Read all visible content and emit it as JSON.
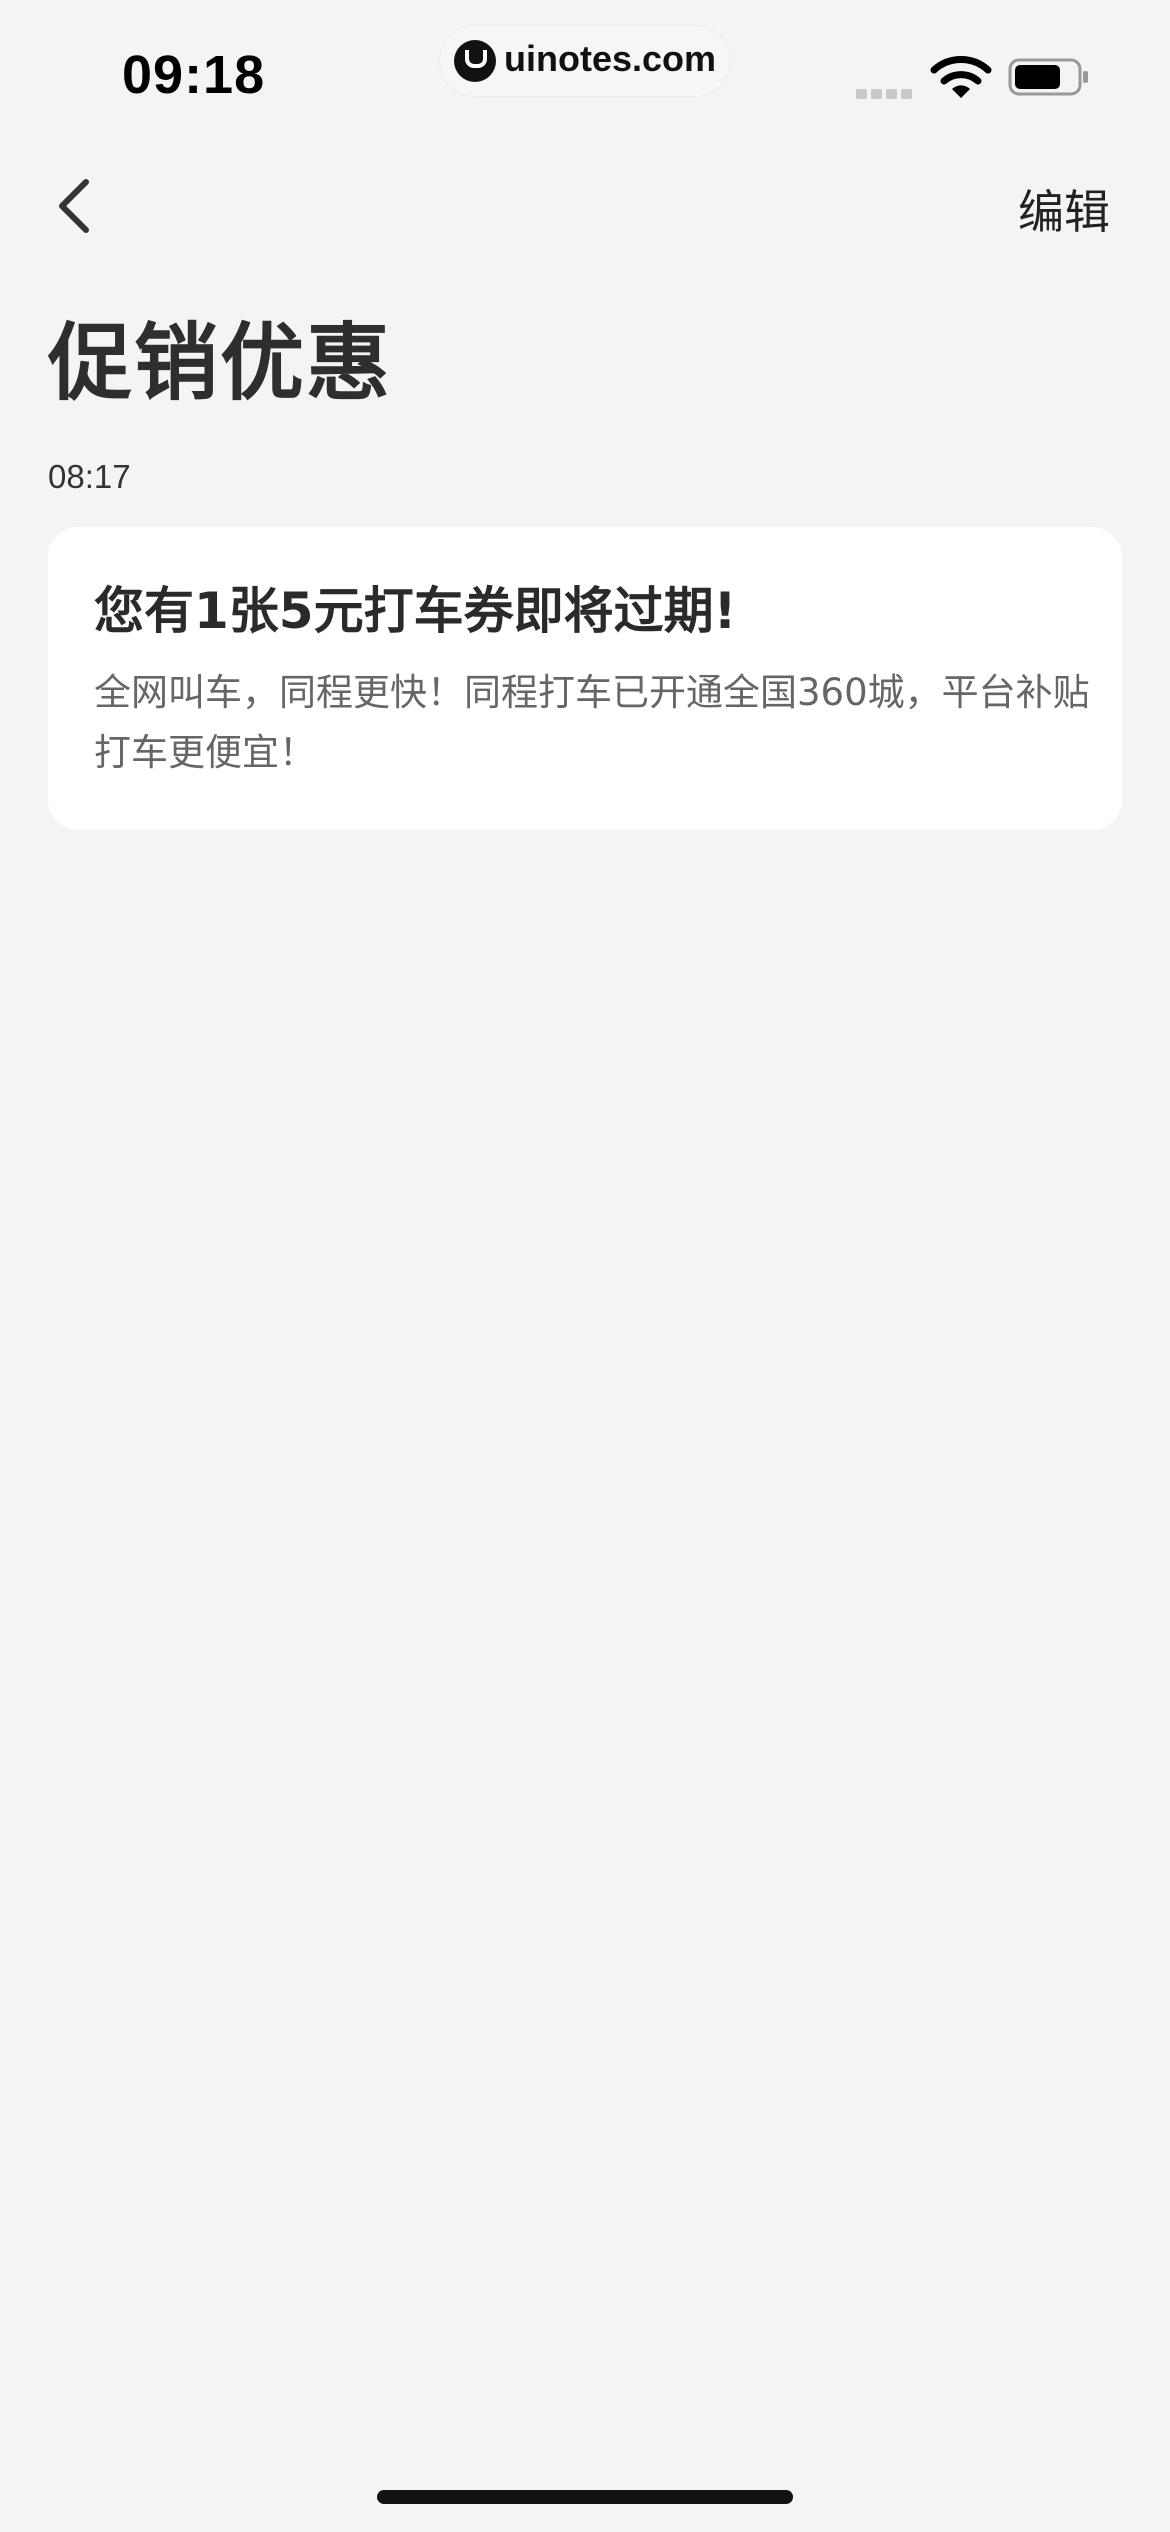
{
  "status_bar": {
    "time": "09:18",
    "watermark": "uinotes.com"
  },
  "nav": {
    "edit_label": "编辑"
  },
  "page": {
    "title": "促销优惠"
  },
  "messages": [
    {
      "time": "08:17",
      "title": "您有1张5元打车券即将过期!",
      "body": "全网叫车，同程更快！同程打车已开通全国360城，平台补贴打车更便宜！"
    }
  ]
}
